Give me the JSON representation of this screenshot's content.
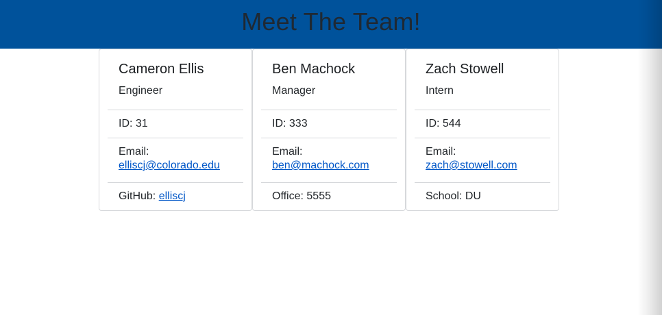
{
  "header": {
    "title": "Meet The Team!",
    "background_color": "#00529b"
  },
  "team": [
    {
      "name": "Cameron Ellis",
      "role": "Engineer",
      "id_label": "ID: 31",
      "email_label": "Email:",
      "email": "elliscj@colorado.edu",
      "extra_label": "GitHub:",
      "extra_value": "elliscj",
      "extra_is_link": true
    },
    {
      "name": "Ben Machock",
      "role": "Manager",
      "id_label": "ID: 333",
      "email_label": "Email:",
      "email": "ben@machock.com",
      "extra_label": "Office:",
      "extra_value": "5555",
      "extra_is_link": false
    },
    {
      "name": "Zach Stowell",
      "role": "Intern",
      "id_label": "ID: 544",
      "email_label": "Email:",
      "email": "zach@stowell.com",
      "extra_label": "School:",
      "extra_value": "DU",
      "extra_is_link": false
    }
  ],
  "link_color": "#0056c7"
}
